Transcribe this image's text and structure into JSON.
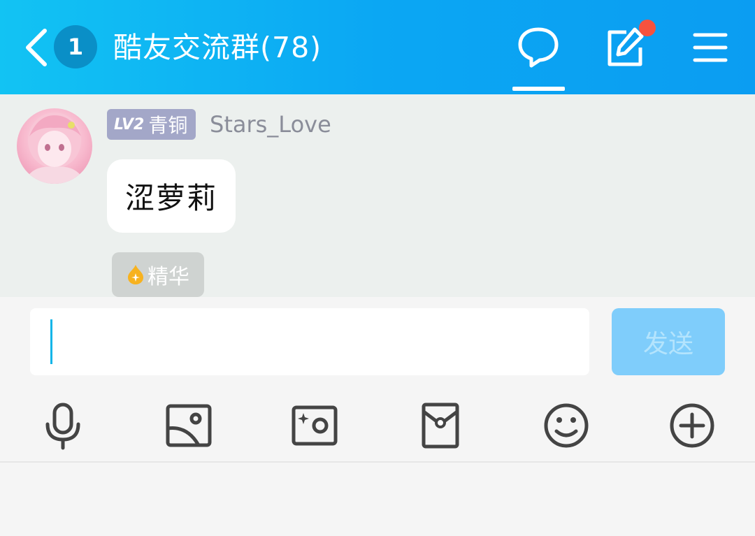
{
  "header": {
    "unread_count": "1",
    "title": "酷友交流群(78)"
  },
  "message": {
    "level_code": "LV2",
    "level_name": "青铜",
    "username": "Stars_Love",
    "text": "涩萝莉"
  },
  "essence_label": "精华",
  "composer": {
    "input_value": "",
    "send_label": "发送"
  },
  "colors": {
    "header_gradient_start": "#12c3f3",
    "header_gradient_end": "#0b9df2",
    "notify_dot": "#f6523e",
    "send_button": "#7fcdfb",
    "chat_background": "#ecf0ee"
  },
  "icons": [
    "back-arrow-icon",
    "chat-bubble-icon",
    "edit-icon",
    "menu-icon",
    "flame-icon",
    "microphone-icon",
    "image-icon",
    "camera-icon",
    "red-envelope-icon",
    "emoji-icon",
    "plus-icon"
  ]
}
